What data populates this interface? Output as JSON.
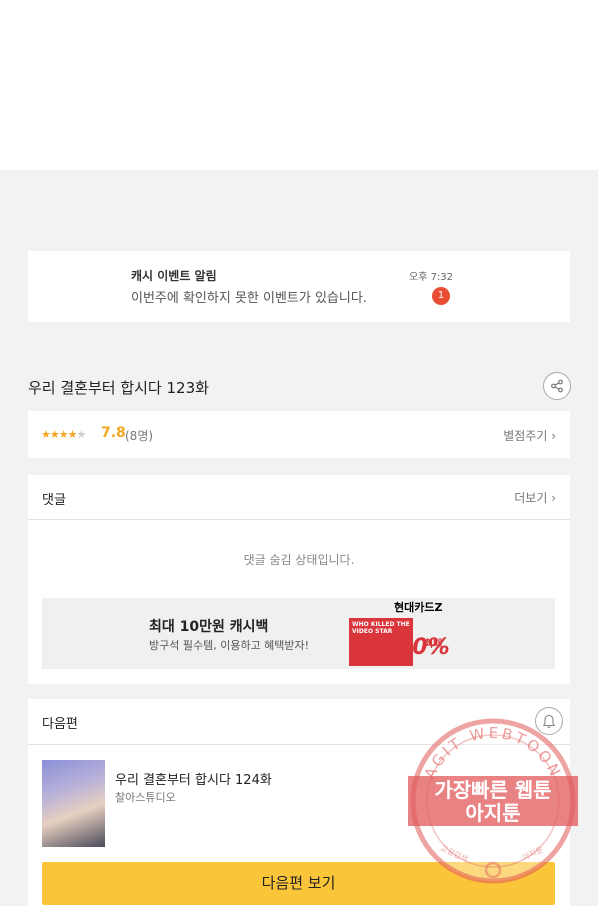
{
  "notification": {
    "title": "캐시 이벤트 알림",
    "body": "이번주에 확인하지 못한 이벤트가 있습니다.",
    "time": "오후 7:32",
    "badge": "1"
  },
  "episode": {
    "title": "우리 결혼부터 합시다 123화",
    "share_icon": "share-icon"
  },
  "rating": {
    "stars_filled": 4,
    "stars_total": 5,
    "score": "7.8",
    "count": "(8명)",
    "rate_link": "별점주기 ›"
  },
  "comments": {
    "label": "댓글",
    "more_link": "더보기 ›",
    "hidden_message": "댓글 숨김 상태입니다."
  },
  "ad": {
    "title": "최대 10만원 캐시백",
    "subtitle": "방구석 필수템, 이용하고 혜택받자!",
    "brand": "현대카드Z",
    "image_text": "WHO KILLED THE VIDEO STAR",
    "percent": "70%",
    "max_label": "최대"
  },
  "next": {
    "label": "다음편",
    "bell_icon": "bell-icon",
    "episode_title": "우리 결혼부터 합시다 124화",
    "studio": "찰아스튜디오",
    "button_label": "다음편 보기"
  },
  "watermark": {
    "ring_text": "AGIT WEBTOON",
    "line1": "가장빠른 웹툰",
    "line2": "아지툰",
    "bottom_left": "고갈검색",
    "bottom_right": "아지툰"
  },
  "colors": {
    "accent_yellow": "#fbc53a",
    "star_orange": "#f5a623",
    "badge_red": "#e94e34"
  }
}
